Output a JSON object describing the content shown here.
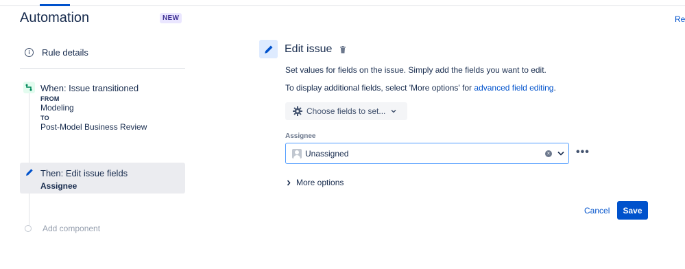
{
  "header": {
    "title": "Automation",
    "badge": "NEW",
    "ref_link": "Ref"
  },
  "sidebar": {
    "rule_details": "Rule details",
    "trigger": {
      "title": "When: Issue transitioned",
      "from_label": "FROM",
      "from_value": "Modeling",
      "to_label": "TO",
      "to_value": "Post-Model Business Review"
    },
    "action": {
      "title": "Then: Edit issue fields",
      "subtitle": "Assignee"
    },
    "add_component": "Add component"
  },
  "main": {
    "title": "Edit issue",
    "description": "Set values for fields on the issue. Simply add the fields you want to edit.",
    "description2_prefix": "To display additional fields, select 'More options' for ",
    "description2_link": "advanced field editing",
    "description2_suffix": ".",
    "choose_fields": "Choose fields to set...",
    "assignee_label": "Assignee",
    "assignee_value": "Unassigned",
    "more_actions": "•••",
    "more_options": "More options",
    "cancel": "Cancel",
    "save": "Save"
  },
  "colors": {
    "primary": "#0052cc",
    "badge_bg": "#eae6ff",
    "selected_bg": "#ebecf0",
    "trigger_icon": "#00875a"
  }
}
